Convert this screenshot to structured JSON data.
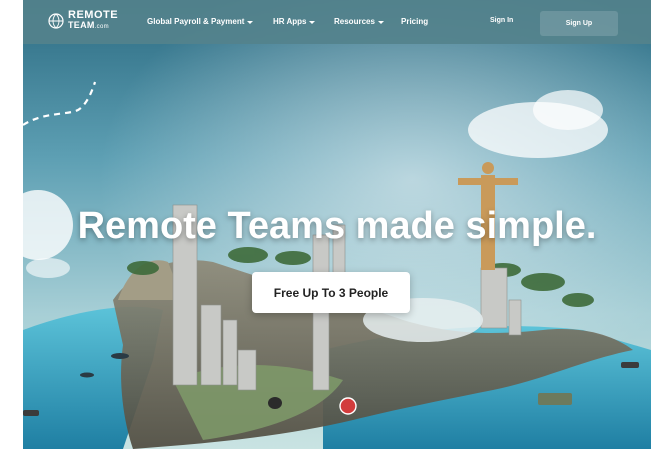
{
  "brand": {
    "line1": "REMOTE",
    "line2": "TEAM",
    "suffix": ".com"
  },
  "nav": {
    "items": [
      {
        "label": "Global Payroll & Payment",
        "has_dropdown": true
      },
      {
        "label": "HR Apps",
        "has_dropdown": true
      },
      {
        "label": "Resources",
        "has_dropdown": true
      },
      {
        "label": "Pricing",
        "has_dropdown": false
      }
    ],
    "sign_in": "Sign In",
    "sign_up": "Sign Up"
  },
  "hero": {
    "headline": "Remote Teams made simple.",
    "cta_label": "Free Up To 3 People"
  },
  "colors": {
    "nav_bg": "#54828c",
    "cta_bg": "#ffffff",
    "headline": "#ffffff",
    "sky_top": "#2f6f86",
    "sea": "#3aa7c8"
  }
}
